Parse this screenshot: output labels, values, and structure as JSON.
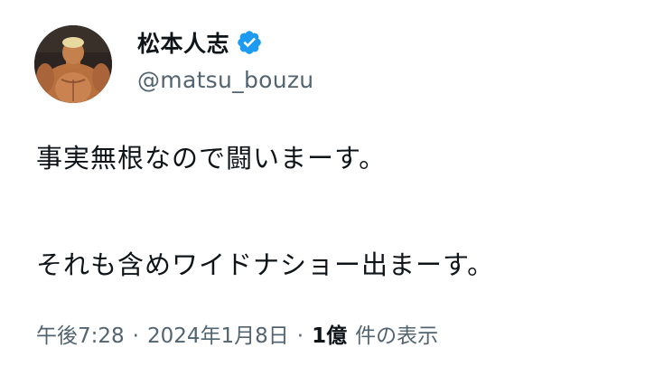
{
  "author": {
    "display_name": "松本人志",
    "handle": "@matsu_bouzu",
    "verified": true
  },
  "tweet": {
    "lines": [
      "事実無根なので闘いまーす。",
      "それも含めワイドナショー出まーす。"
    ]
  },
  "meta": {
    "time": "午後7:28",
    "separator": "·",
    "date": "2024年1月8日",
    "views_count": "1億",
    "views_label": "件の表示"
  },
  "colors": {
    "text": "#0f1419",
    "secondary": "#536471",
    "verified_badge": "#1d9bf0"
  },
  "icons": {
    "verified": "verified-badge-icon"
  }
}
